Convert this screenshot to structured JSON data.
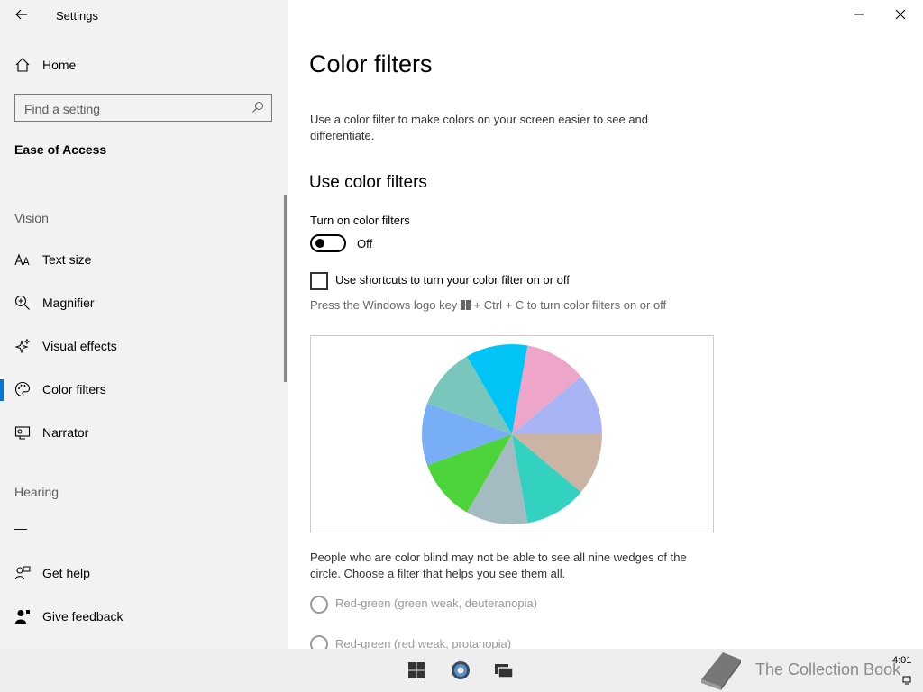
{
  "window": {
    "title": "Settings"
  },
  "sidebar": {
    "home": "Home",
    "search_placeholder": "Find a setting",
    "category": "Ease of Access",
    "vision_header": "Vision",
    "hearing_header": "Hearing",
    "hearing_item": "—",
    "items": [
      {
        "label": "Text size",
        "icon": "text-size-icon"
      },
      {
        "label": "Magnifier",
        "icon": "magnifier-icon"
      },
      {
        "label": "Visual effects",
        "icon": "visual-effects-icon"
      },
      {
        "label": "Color filters",
        "icon": "palette-icon",
        "selected": true
      },
      {
        "label": "Narrator",
        "icon": "narrator-icon"
      }
    ],
    "get_help": "Get help",
    "give_feedback": "Give feedback"
  },
  "main": {
    "title": "Color filters",
    "description": "Use a color filter to make colors on your screen easier to see and differentiate.",
    "section_title": "Use color filters",
    "toggle_label": "Turn on color filters",
    "toggle_state": "Off",
    "checkbox_label": "Use shortcuts to turn your color filter on or off",
    "shortcut_hint_prefix": "Press the Windows logo key",
    "shortcut_hint_suffix": "+ Ctrl + C to turn color filters on or off",
    "explanation": "People who are color blind may not be able to see all nine wedges of the circle. Choose a filter that helps you see them all.",
    "radio_options": [
      "Red-green (green weak, deuteranopia)",
      "Red-green (red weak, protanopia)"
    ],
    "wedge_colors": [
      "#a9b4f5",
      "#cbb4a3",
      "#33d1c0",
      "#a5bbc2",
      "#4dd43a",
      "#77aef5",
      "#78c6bc",
      "#00c4f5",
      "#eda6c9"
    ]
  },
  "taskbar": {
    "clock": "4:01",
    "watermark": "The Collection Book"
  },
  "colors": {
    "accent": "#0078d7",
    "sidebar_bg": "#f2f2f2",
    "taskbar_bg": "#eeeeee"
  }
}
